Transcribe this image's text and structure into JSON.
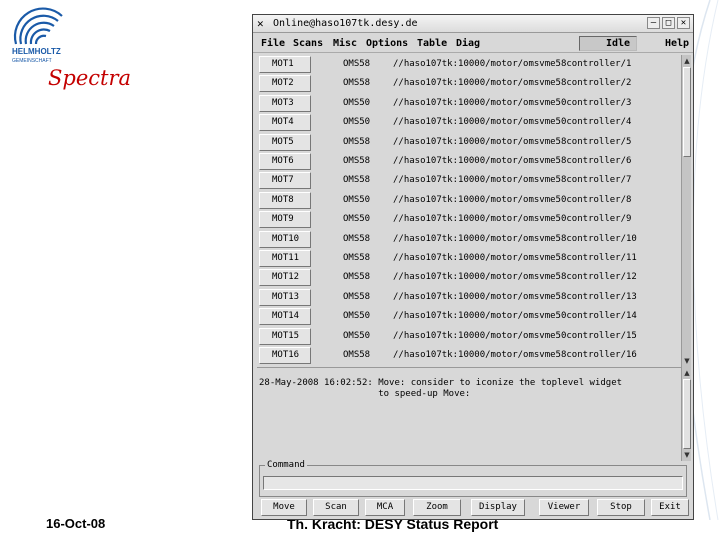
{
  "slide": {
    "title": "Spectra",
    "logo_text": "HELMHOLTZ",
    "logo_sub": "GEMEINSCHAFT",
    "footer_date": "16-Oct-08",
    "footer_title": "Th. Kracht: DESY Status Report"
  },
  "window": {
    "title": "Online@haso107tk.desy.de",
    "menu": [
      "File",
      "Scans",
      "Misc",
      "Options",
      "Table",
      "Diag",
      "Help"
    ],
    "status": "Idle"
  },
  "motors": [
    {
      "name": "MOT1",
      "type": "OMS58",
      "path": "//haso107tk:10000/motor/omsvme58controller/1"
    },
    {
      "name": "MOT2",
      "type": "OMS58",
      "path": "//haso107tk:10000/motor/omsvme58controller/2"
    },
    {
      "name": "MOT3",
      "type": "OMS50",
      "path": "//haso107tk:10000/motor/omsvme50controller/3"
    },
    {
      "name": "MOT4",
      "type": "OMS50",
      "path": "//haso107tk:10000/motor/omsvme50controller/4"
    },
    {
      "name": "MOT5",
      "type": "OMS58",
      "path": "//haso107tk:10000/motor/omsvme58controller/5"
    },
    {
      "name": "MOT6",
      "type": "OMS58",
      "path": "//haso107tk:10000/motor/omsvme58controller/6"
    },
    {
      "name": "MOT7",
      "type": "OMS58",
      "path": "//haso107tk:10000/motor/omsvme58controller/7"
    },
    {
      "name": "MOT8",
      "type": "OMS50",
      "path": "//haso107tk:10000/motor/omsvme50controller/8"
    },
    {
      "name": "MOT9",
      "type": "OMS50",
      "path": "//haso107tk:10000/motor/omsvme50controller/9"
    },
    {
      "name": "MOT10",
      "type": "OMS58",
      "path": "//haso107tk:10000/motor/omsvme58controller/10"
    },
    {
      "name": "MOT11",
      "type": "OMS58",
      "path": "//haso107tk:10000/motor/omsvme58controller/11"
    },
    {
      "name": "MOT12",
      "type": "OMS58",
      "path": "//haso107tk:10000/motor/omsvme58controller/12"
    },
    {
      "name": "MOT13",
      "type": "OMS58",
      "path": "//haso107tk:10000/motor/omsvme58controller/13"
    },
    {
      "name": "MOT14",
      "type": "OMS50",
      "path": "//haso107tk:10000/motor/omsvme50controller/14"
    },
    {
      "name": "MOT15",
      "type": "OMS50",
      "path": "//haso107tk:10000/motor/omsvme50controller/15"
    },
    {
      "name": "MOT16",
      "type": "OMS58",
      "path": "//haso107tk:10000/motor/omsvme58controller/16"
    }
  ],
  "log": {
    "line1": "28-May-2008 16:02:52: Move: consider to iconize the toplevel widget",
    "line2": "                      to speed-up Move:"
  },
  "command": {
    "label": "Command",
    "value": ""
  },
  "buttons": [
    "Move",
    "Scan",
    "MCA",
    "Zoom",
    "Display",
    "Viewer",
    "Stop",
    "Exit"
  ],
  "colors": {
    "title_red": "#c40000",
    "window_bg": "#d8d8d8",
    "logo_blue": "#1a5aa8"
  }
}
